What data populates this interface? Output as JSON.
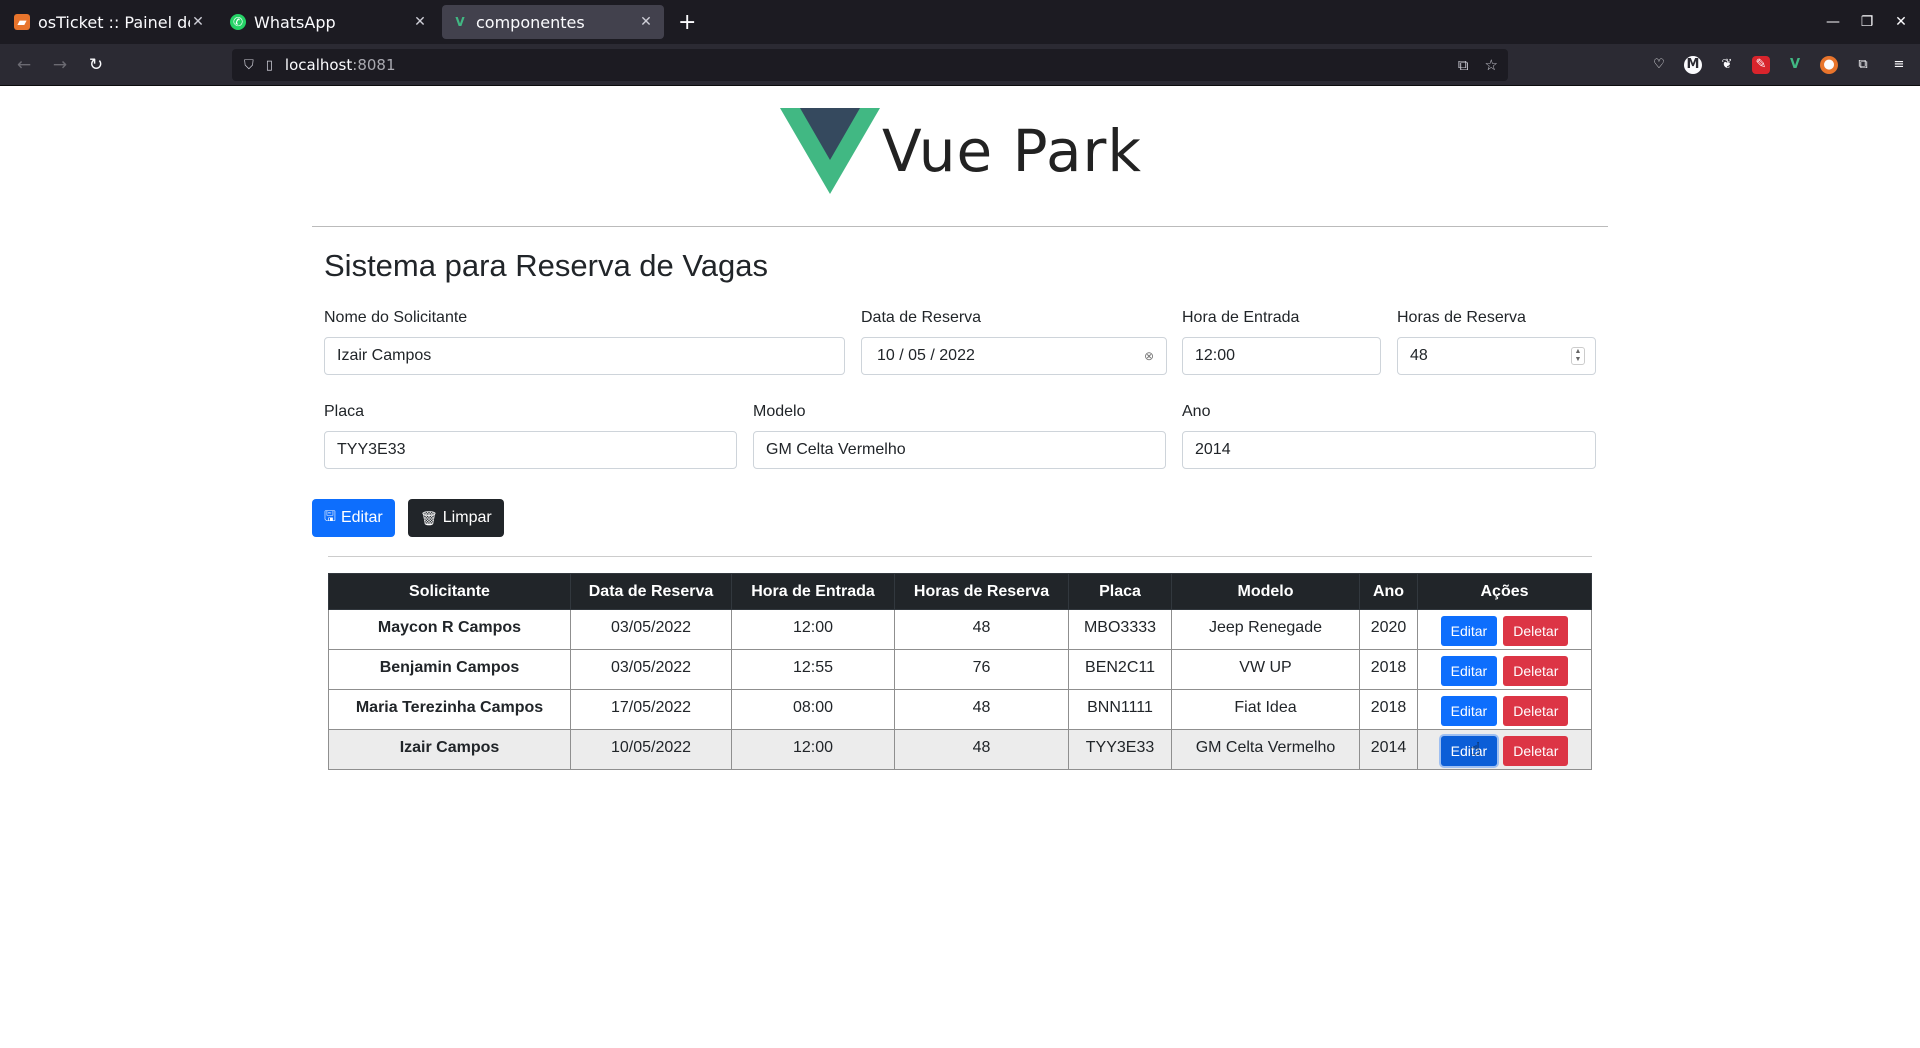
{
  "browser": {
    "tabs": [
      {
        "title": "osTicket :: Painel de Contr",
        "icon": "osticket-icon",
        "color": "#e8742c"
      },
      {
        "title": "WhatsApp",
        "icon": "whatsapp-icon",
        "color": "#25d366"
      },
      {
        "title": "componentes",
        "icon": "vue-icon",
        "color": "#41b883"
      }
    ],
    "url_host": "localhost",
    "url_port": ":8081"
  },
  "logo": {
    "name": "Vue Park",
    "colors": {
      "outer": "#41b883",
      "inner": "#35495e"
    }
  },
  "form": {
    "title": "Sistema para Reserva de Vagas",
    "nome_label": "Nome do Solicitante",
    "nome_value": "Izair Campos",
    "data_label": "Data de Reserva",
    "data_value": "10 / 05 / 2022",
    "hora_label": "Hora de Entrada",
    "hora_value": "12:00",
    "horas_label": "Horas de Reserva",
    "horas_value": "48",
    "placa_label": "Placa",
    "placa_value": "TYY3E33",
    "modelo_label": "Modelo",
    "modelo_value": "GM Celta Vermelho",
    "ano_label": "Ano",
    "ano_value": "2014",
    "edit_button": "Editar",
    "clear_button": "Limpar"
  },
  "table": {
    "headers": [
      "Solicitante",
      "Data de Reserva",
      "Hora de Entrada",
      "Horas de Reserva",
      "Placa",
      "Modelo",
      "Ano",
      "Ações"
    ],
    "edit_label": "Editar",
    "delete_label": "Deletar",
    "rows": [
      {
        "solicitante": "Maycon R Campos",
        "data": "03/05/2022",
        "hora": "12:00",
        "horas": "48",
        "placa": "MBO3333",
        "modelo": "Jeep Renegade",
        "ano": "2020"
      },
      {
        "solicitante": "Benjamin Campos",
        "data": "03/05/2022",
        "hora": "12:55",
        "horas": "76",
        "placa": "BEN2C11",
        "modelo": "VW UP",
        "ano": "2018"
      },
      {
        "solicitante": "Maria Terezinha Campos",
        "data": "17/05/2022",
        "hora": "08:00",
        "horas": "48",
        "placa": "BNN1111",
        "modelo": "Fiat Idea",
        "ano": "2018"
      },
      {
        "solicitante": "Izair Campos",
        "data": "10/05/2022",
        "hora": "12:00",
        "horas": "48",
        "placa": "TYY3E33",
        "modelo": "GM Celta Vermelho",
        "ano": "2014"
      }
    ]
  }
}
